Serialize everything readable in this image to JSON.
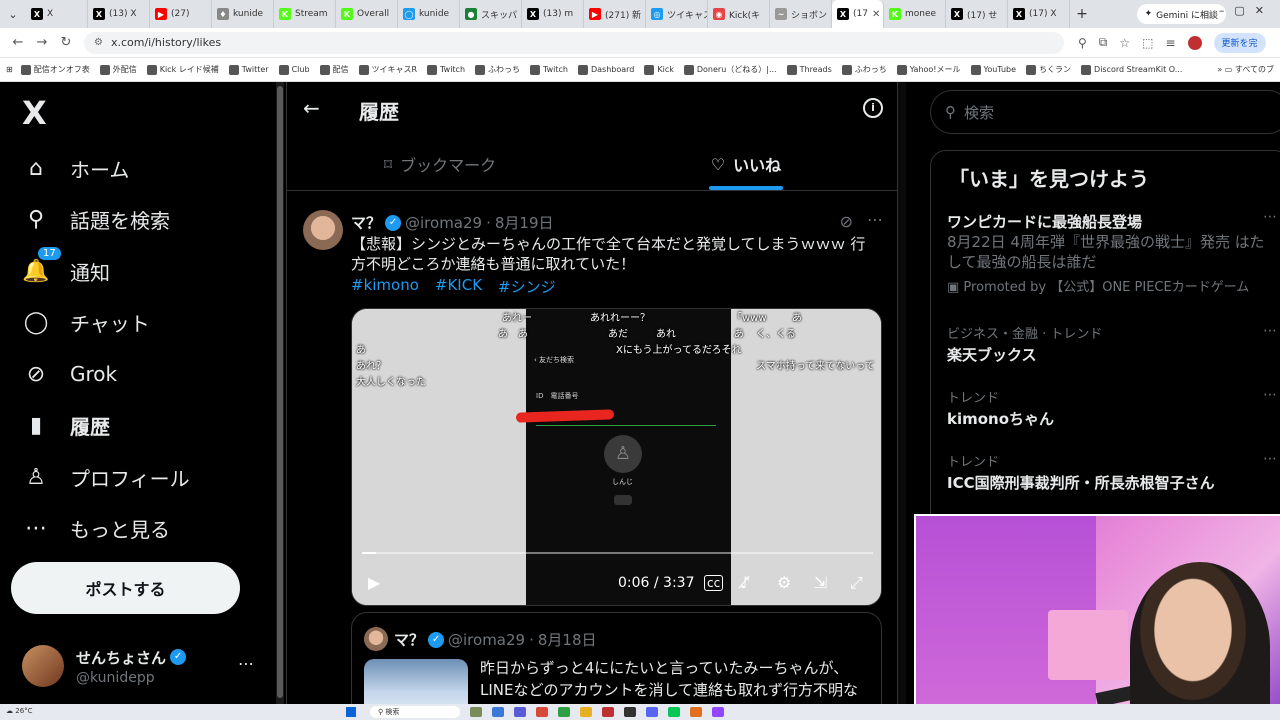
{
  "browser": {
    "tabs": [
      {
        "label": "X",
        "color": "#000000",
        "glyph": "X"
      },
      {
        "label": "(13) X",
        "color": "#000000",
        "glyph": "X"
      },
      {
        "label": "(27)",
        "color": "#ff0000",
        "glyph": "▶"
      },
      {
        "label": "kunide",
        "color": "#888888",
        "glyph": "♦"
      },
      {
        "label": "Stream",
        "color": "#53fc18",
        "glyph": "K"
      },
      {
        "label": "Overall",
        "color": "#53fc18",
        "glyph": "K"
      },
      {
        "label": "kunide",
        "color": "#1d9bf0",
        "glyph": "◯"
      },
      {
        "label": "スキッパ",
        "color": "#1a7f37",
        "glyph": "●"
      },
      {
        "label": "(13) m",
        "color": "#000000",
        "glyph": "X"
      },
      {
        "label": "(271) 新",
        "color": "#ff0000",
        "glyph": "▶"
      },
      {
        "label": "ツイキャス",
        "color": "#1d9bf0",
        "glyph": "◎"
      },
      {
        "label": "Kick(キ",
        "color": "#e64545",
        "glyph": "◉"
      },
      {
        "label": "ショボン",
        "color": "#999999",
        "glyph": "~"
      },
      {
        "label": "(17",
        "color": "#000000",
        "glyph": "X",
        "active": true
      },
      {
        "label": "monee",
        "color": "#53fc18",
        "glyph": "K"
      },
      {
        "label": "(17) せ",
        "color": "#000000",
        "glyph": "X"
      },
      {
        "label": "(17) X",
        "color": "#000000",
        "glyph": "X"
      }
    ],
    "gemini_label": "Gemini に相談",
    "url": "x.com/i/history/likes",
    "update_label": "更新を完",
    "bookmarks": [
      "配信オンオフ表",
      "外配信",
      "Kick レイド候補",
      "Twitter",
      "Club",
      "配信",
      "ツイキャスR",
      "Twitch",
      "ふわっち",
      "Twitch",
      "Dashboard",
      "Kick",
      "Doneru（どねる）|...",
      "Threads",
      "ふわっち",
      "Yahoo!メール",
      "YouTube",
      "ちくラン",
      "Discord StreamKit O..."
    ],
    "bookmarks_all": "すべてのブ"
  },
  "nav": {
    "logo": "X",
    "items": [
      {
        "label": "ホーム",
        "icon": "⌂",
        "icon_name": "home-icon"
      },
      {
        "label": "話題を検索",
        "icon": "⚲",
        "icon_name": "search-icon"
      },
      {
        "label": "通知",
        "icon": "🔔",
        "icon_name": "bell-icon",
        "badge": "17"
      },
      {
        "label": "チャット",
        "icon": "◯",
        "icon_name": "chat-icon"
      },
      {
        "label": "Grok",
        "icon": "⊘",
        "icon_name": "grok-icon"
      },
      {
        "label": "履歴",
        "icon": "▮",
        "icon_name": "bookmark-icon",
        "bold": true
      },
      {
        "label": "プロフィール",
        "icon": "♙",
        "icon_name": "profile-icon"
      },
      {
        "label": "もっと見る",
        "icon": "⋯",
        "icon_name": "more-icon"
      }
    ],
    "post_button": "ポストする",
    "account": {
      "display_name": "せんちょさん",
      "handle": "@kunidepp"
    }
  },
  "main": {
    "title": "履歴",
    "tabs": [
      {
        "label": "ブックマーク",
        "icon": "⌑"
      },
      {
        "label": "いいね",
        "icon": "♡",
        "active": true
      }
    ],
    "tweet": {
      "name": "マ？",
      "handle": "@iroma29",
      "date": "8月19日",
      "text": "【悲報】シンジとみーちゃんの工作で全て台本だと発覚してしまうｗｗｗ 行方不明どころか連絡も普通に取れていた！",
      "hashtags": [
        "#kimono",
        "#KICK",
        "#シンジ"
      ],
      "video": {
        "time": "0:06 / 3:37",
        "progress": 0.027,
        "comments": [
          "あれー",
          "あれれーー？",
          "「www",
          "あ",
          "あ　あ",
          "あだ",
          "あれ",
          "Xにもう上がってるだろそれ",
          "あ",
          "く、くる",
          "あれ？",
          "大人しくなった",
          "スマホ持って来てないって",
          "あ"
        ],
        "phone": {
          "title": "友だち検索",
          "radio": "ID　電話番号",
          "name": "しんじ"
        }
      },
      "quote": {
        "name": "マ？",
        "handle": "@iroma29",
        "date": "8月18日",
        "text": "昨日からずっと4ににたいと言っていたみーちゃんが、LINEなどのアカウントを消して連絡も取れず行方不明な模様"
      }
    }
  },
  "right": {
    "search_placeholder": "検索",
    "trends_title": "「いま」を見つけよう",
    "trends": [
      {
        "meta": "",
        "title": "ワンピカードに最強船長登場",
        "desc": "8月22日 4周年弾『世界最強の戦士』発売 はたして最強の船長は誰だ",
        "promo": "Promoted by 【公式】ONE PIECEカードゲーム"
      },
      {
        "meta": "ビジネス・金融 · トレンド",
        "title": "楽天ブックス"
      },
      {
        "meta": "トレンド",
        "title": "kimonoちゃん"
      },
      {
        "meta": "トレンド",
        "title": "ICC国際刑事裁判所・所長赤根智子さん"
      }
    ]
  },
  "taskbar": {
    "weather": "26°C",
    "search": "検索"
  }
}
